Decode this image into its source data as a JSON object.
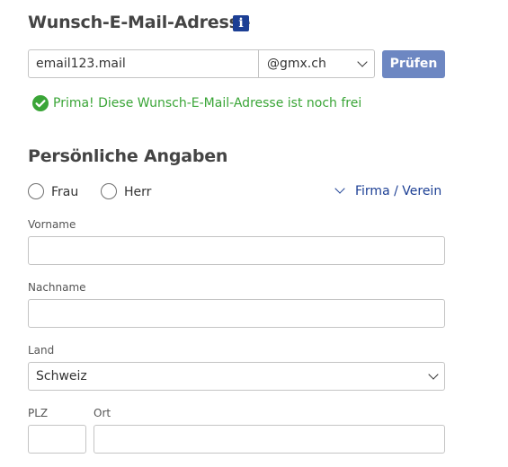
{
  "email_section": {
    "title": "Wunsch-E-Mail-Adresse",
    "info_icon": "i",
    "email_value": "email123.mail",
    "domain_selected": "@gmx.ch",
    "check_button": "Prüfen",
    "success_message": "Prima! Diese Wunsch-E-Mail-Adresse ist noch frei"
  },
  "personal_section": {
    "title": "Persönliche Angaben",
    "salutation_options": [
      "Frau",
      "Herr"
    ],
    "company_link": "Firma / Verein",
    "fields": {
      "first_name_label": "Vorname",
      "first_name_value": "",
      "last_name_label": "Nachname",
      "last_name_value": "",
      "country_label": "Land",
      "country_selected": "Schweiz",
      "zip_label": "PLZ",
      "zip_value": "",
      "city_label": "Ort",
      "city_value": ""
    }
  },
  "colors": {
    "info_badge": "#1c3f94",
    "button": "#6d87c2",
    "success": "#3aa537",
    "link": "#1c3f94"
  }
}
